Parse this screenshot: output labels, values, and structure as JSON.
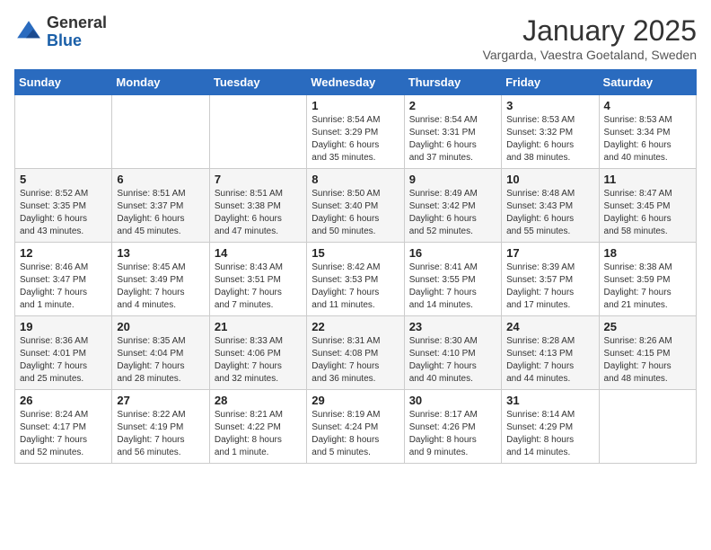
{
  "logo": {
    "general": "General",
    "blue": "Blue"
  },
  "calendar": {
    "title": "January 2025",
    "subtitle": "Vargarda, Vaestra Goetaland, Sweden"
  },
  "headers": [
    "Sunday",
    "Monday",
    "Tuesday",
    "Wednesday",
    "Thursday",
    "Friday",
    "Saturday"
  ],
  "weeks": [
    [
      {
        "day": "",
        "info": ""
      },
      {
        "day": "",
        "info": ""
      },
      {
        "day": "",
        "info": ""
      },
      {
        "day": "1",
        "info": "Sunrise: 8:54 AM\nSunset: 3:29 PM\nDaylight: 6 hours\nand 35 minutes."
      },
      {
        "day": "2",
        "info": "Sunrise: 8:54 AM\nSunset: 3:31 PM\nDaylight: 6 hours\nand 37 minutes."
      },
      {
        "day": "3",
        "info": "Sunrise: 8:53 AM\nSunset: 3:32 PM\nDaylight: 6 hours\nand 38 minutes."
      },
      {
        "day": "4",
        "info": "Sunrise: 8:53 AM\nSunset: 3:34 PM\nDaylight: 6 hours\nand 40 minutes."
      }
    ],
    [
      {
        "day": "5",
        "info": "Sunrise: 8:52 AM\nSunset: 3:35 PM\nDaylight: 6 hours\nand 43 minutes."
      },
      {
        "day": "6",
        "info": "Sunrise: 8:51 AM\nSunset: 3:37 PM\nDaylight: 6 hours\nand 45 minutes."
      },
      {
        "day": "7",
        "info": "Sunrise: 8:51 AM\nSunset: 3:38 PM\nDaylight: 6 hours\nand 47 minutes."
      },
      {
        "day": "8",
        "info": "Sunrise: 8:50 AM\nSunset: 3:40 PM\nDaylight: 6 hours\nand 50 minutes."
      },
      {
        "day": "9",
        "info": "Sunrise: 8:49 AM\nSunset: 3:42 PM\nDaylight: 6 hours\nand 52 minutes."
      },
      {
        "day": "10",
        "info": "Sunrise: 8:48 AM\nSunset: 3:43 PM\nDaylight: 6 hours\nand 55 minutes."
      },
      {
        "day": "11",
        "info": "Sunrise: 8:47 AM\nSunset: 3:45 PM\nDaylight: 6 hours\nand 58 minutes."
      }
    ],
    [
      {
        "day": "12",
        "info": "Sunrise: 8:46 AM\nSunset: 3:47 PM\nDaylight: 7 hours\nand 1 minute."
      },
      {
        "day": "13",
        "info": "Sunrise: 8:45 AM\nSunset: 3:49 PM\nDaylight: 7 hours\nand 4 minutes."
      },
      {
        "day": "14",
        "info": "Sunrise: 8:43 AM\nSunset: 3:51 PM\nDaylight: 7 hours\nand 7 minutes."
      },
      {
        "day": "15",
        "info": "Sunrise: 8:42 AM\nSunset: 3:53 PM\nDaylight: 7 hours\nand 11 minutes."
      },
      {
        "day": "16",
        "info": "Sunrise: 8:41 AM\nSunset: 3:55 PM\nDaylight: 7 hours\nand 14 minutes."
      },
      {
        "day": "17",
        "info": "Sunrise: 8:39 AM\nSunset: 3:57 PM\nDaylight: 7 hours\nand 17 minutes."
      },
      {
        "day": "18",
        "info": "Sunrise: 8:38 AM\nSunset: 3:59 PM\nDaylight: 7 hours\nand 21 minutes."
      }
    ],
    [
      {
        "day": "19",
        "info": "Sunrise: 8:36 AM\nSunset: 4:01 PM\nDaylight: 7 hours\nand 25 minutes."
      },
      {
        "day": "20",
        "info": "Sunrise: 8:35 AM\nSunset: 4:04 PM\nDaylight: 7 hours\nand 28 minutes."
      },
      {
        "day": "21",
        "info": "Sunrise: 8:33 AM\nSunset: 4:06 PM\nDaylight: 7 hours\nand 32 minutes."
      },
      {
        "day": "22",
        "info": "Sunrise: 8:31 AM\nSunset: 4:08 PM\nDaylight: 7 hours\nand 36 minutes."
      },
      {
        "day": "23",
        "info": "Sunrise: 8:30 AM\nSunset: 4:10 PM\nDaylight: 7 hours\nand 40 minutes."
      },
      {
        "day": "24",
        "info": "Sunrise: 8:28 AM\nSunset: 4:13 PM\nDaylight: 7 hours\nand 44 minutes."
      },
      {
        "day": "25",
        "info": "Sunrise: 8:26 AM\nSunset: 4:15 PM\nDaylight: 7 hours\nand 48 minutes."
      }
    ],
    [
      {
        "day": "26",
        "info": "Sunrise: 8:24 AM\nSunset: 4:17 PM\nDaylight: 7 hours\nand 52 minutes."
      },
      {
        "day": "27",
        "info": "Sunrise: 8:22 AM\nSunset: 4:19 PM\nDaylight: 7 hours\nand 56 minutes."
      },
      {
        "day": "28",
        "info": "Sunrise: 8:21 AM\nSunset: 4:22 PM\nDaylight: 8 hours\nand 1 minute."
      },
      {
        "day": "29",
        "info": "Sunrise: 8:19 AM\nSunset: 4:24 PM\nDaylight: 8 hours\nand 5 minutes."
      },
      {
        "day": "30",
        "info": "Sunrise: 8:17 AM\nSunset: 4:26 PM\nDaylight: 8 hours\nand 9 minutes."
      },
      {
        "day": "31",
        "info": "Sunrise: 8:14 AM\nSunset: 4:29 PM\nDaylight: 8 hours\nand 14 minutes."
      },
      {
        "day": "",
        "info": ""
      }
    ]
  ]
}
